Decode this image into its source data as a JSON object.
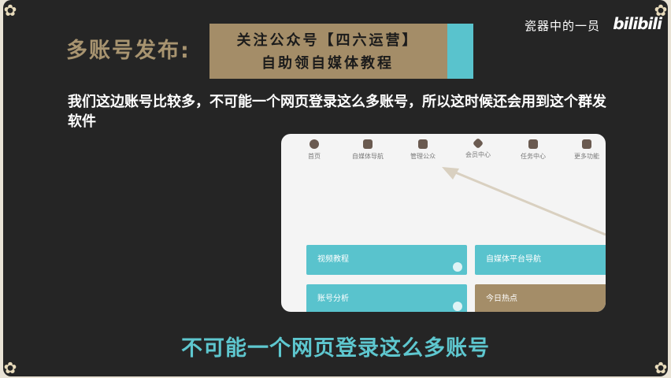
{
  "colors": {
    "background": "#252525",
    "frame": "#e9e3d6",
    "gold": "#a48d68",
    "teal": "#59c3cd",
    "text": "#ffffff"
  },
  "header": {
    "channel_name": "瓷器中的一员",
    "logo_text": "bilibili"
  },
  "slide": {
    "section_title": "多账号发布:",
    "banner_line1": "关注公众号【四六运营】",
    "banner_line2": "自助领自媒体教程",
    "body_text": "我们这边账号比较多，不可能一个网页登录这么多账号，所以这时候还会用到这个群发软件"
  },
  "screenshot": {
    "nav_items": [
      {
        "label": "首页",
        "icon": "home-icon"
      },
      {
        "label": "自媒体导航",
        "icon": "nav-icon"
      },
      {
        "label": "管理公众",
        "icon": "manage-icon"
      },
      {
        "label": "会员中心",
        "icon": "diamond-icon"
      },
      {
        "label": "任务中心",
        "icon": "gift-icon"
      },
      {
        "label": "更多功能",
        "icon": "grid-icon"
      }
    ],
    "cards": [
      {
        "label": "视频教程",
        "color": "#59c3cd"
      },
      {
        "label": "自媒体平台导航",
        "color": "#59c3cd"
      },
      {
        "label": "账号分析",
        "color": "#59c3cd"
      },
      {
        "label": "今日热点",
        "color": "#a48d68"
      }
    ]
  },
  "caption": "不可能一个网页登录这么多账号"
}
